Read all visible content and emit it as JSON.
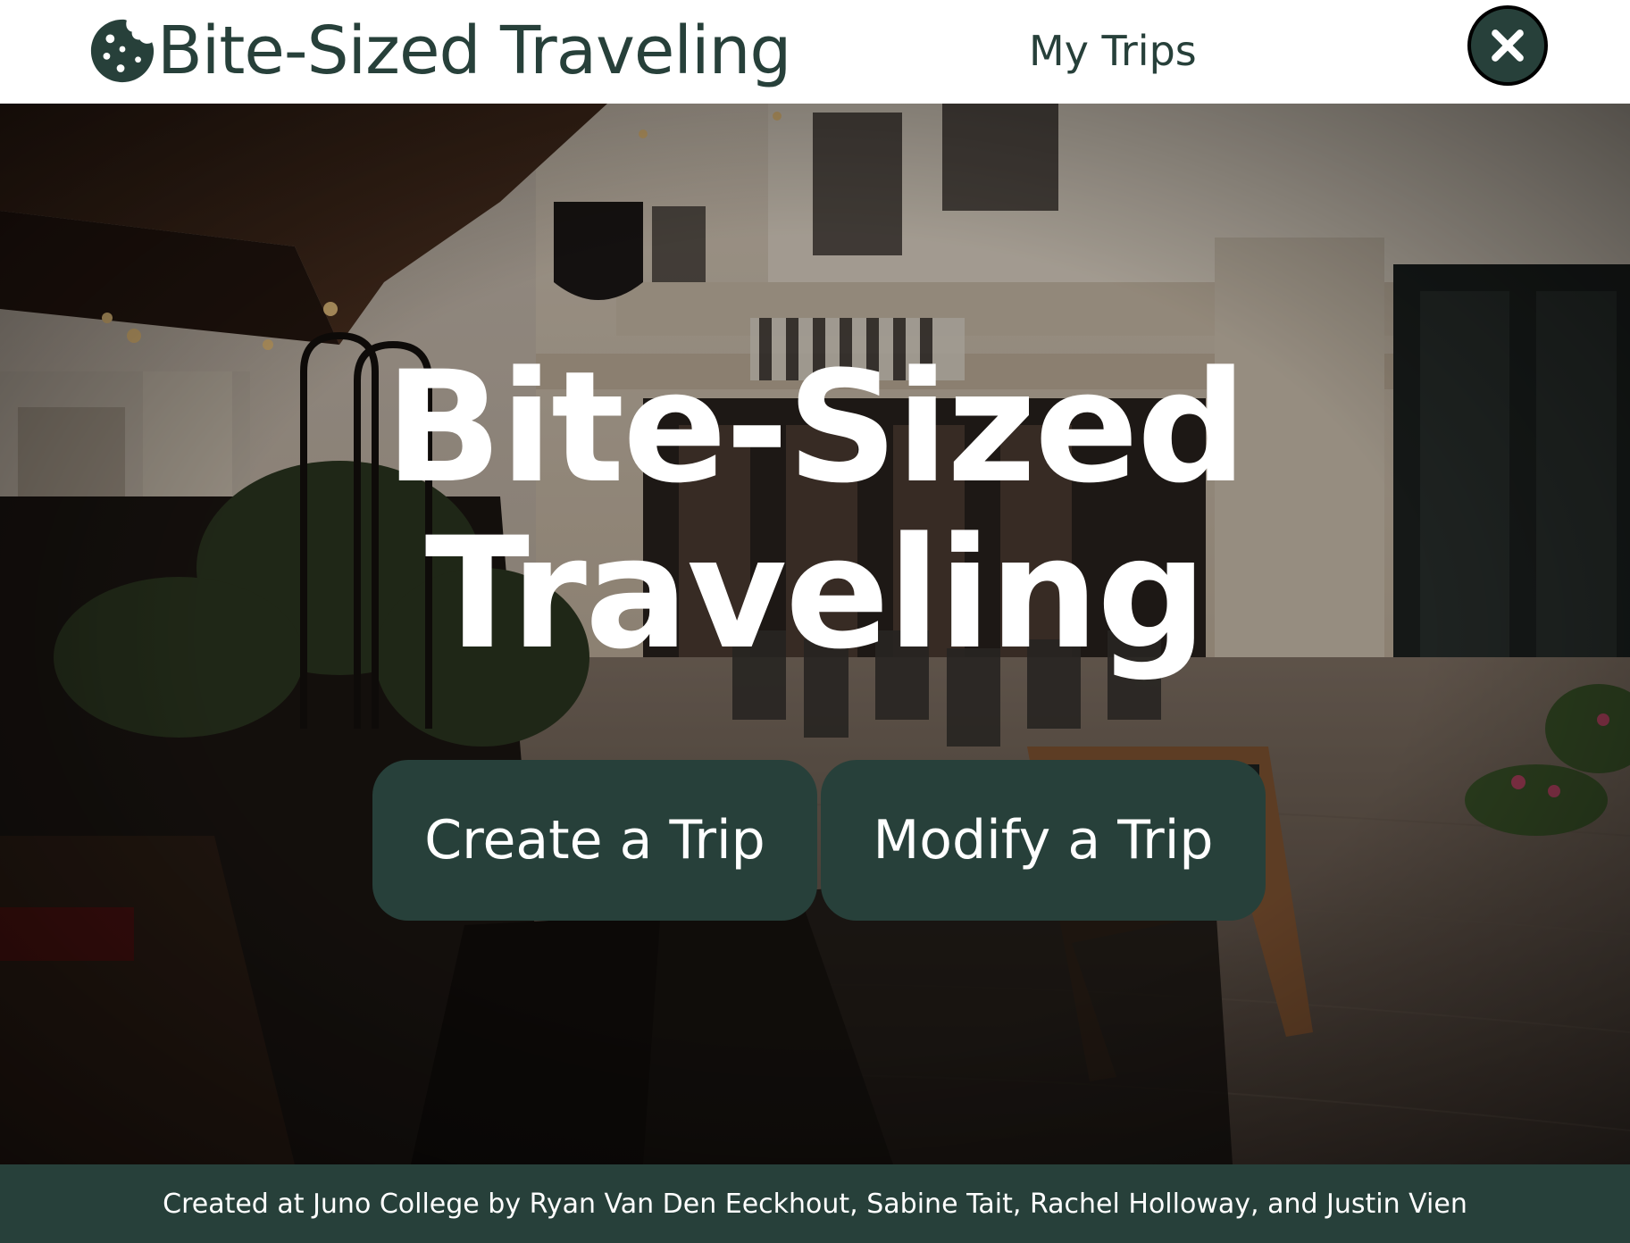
{
  "header": {
    "logo_text": "Bite-Sized Traveling",
    "logo_icon": "cookie-icon",
    "nav_link": "My Trips",
    "close_icon": "close-icon"
  },
  "hero": {
    "title_line1": "Bite-Sized",
    "title_line2": "Traveling",
    "background": "street-cafe-photo"
  },
  "actions": {
    "create_label": "Create a Trip",
    "modify_label": "Modify a Trip"
  },
  "footer": {
    "credit": "Created at Juno College by Ryan Van Den Eeckhout, Sabine Tait, Rachel Holloway, and Justin Vien"
  },
  "colors": {
    "brand": "#27403a",
    "header_bg": "#ffffff",
    "text_on_brand": "#ffffff"
  }
}
